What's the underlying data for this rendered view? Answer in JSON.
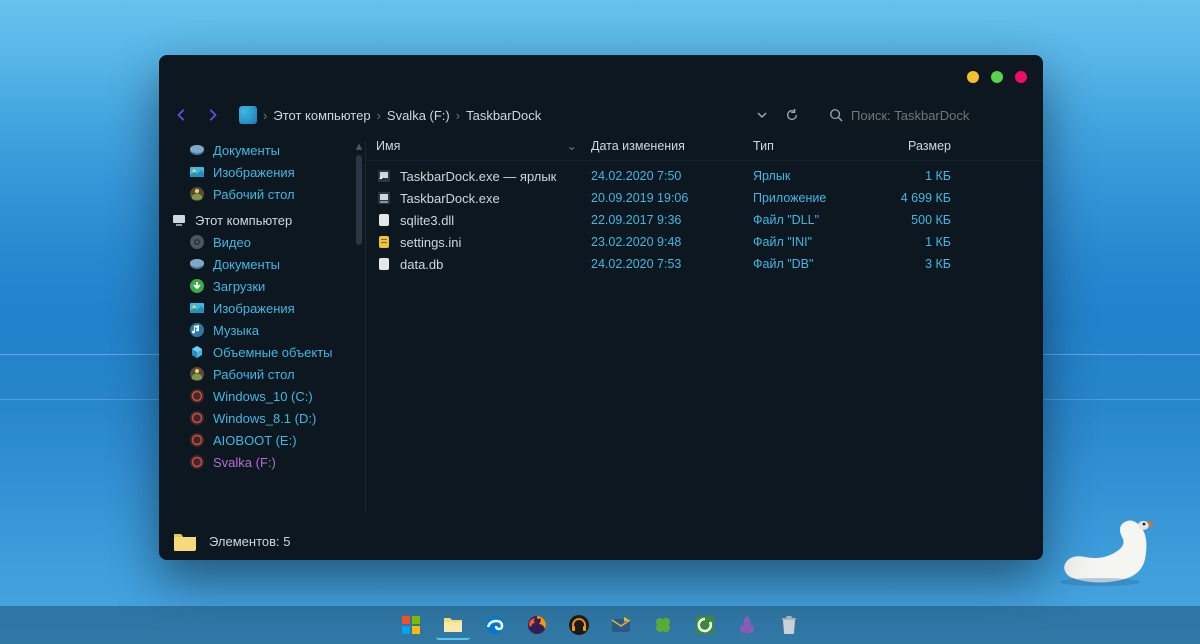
{
  "breadcrumb": {
    "root": "Этот компьютер",
    "drive": "Svalka (F:)",
    "folder": "TaskbarDock"
  },
  "search": {
    "placeholder": "Поиск: TaskbarDock"
  },
  "columns": {
    "name": "Имя",
    "date": "Дата изменения",
    "type": "Тип",
    "size": "Размер"
  },
  "sidebar": {
    "quick": [
      {
        "label": "Документы",
        "icon": "docs"
      },
      {
        "label": "Изображения",
        "icon": "images"
      },
      {
        "label": "Рабочий стол",
        "icon": "desktop"
      }
    ],
    "pc_label": "Этот компьютер",
    "pc": [
      {
        "label": "Видео",
        "icon": "video"
      },
      {
        "label": "Документы",
        "icon": "docs"
      },
      {
        "label": "Загрузки",
        "icon": "downloads"
      },
      {
        "label": "Изображения",
        "icon": "images"
      },
      {
        "label": "Музыка",
        "icon": "music"
      },
      {
        "label": "Объемные объекты",
        "icon": "3d"
      },
      {
        "label": "Рабочий стол",
        "icon": "desktop"
      },
      {
        "label": "Windows_10 (C:)",
        "icon": "drive-red"
      },
      {
        "label": "Windows_8.1 (D:)",
        "icon": "drive-red"
      },
      {
        "label": "AIOBOOT (E:)",
        "icon": "drive-red"
      },
      {
        "label": "Svalka (F:)",
        "icon": "drive-red",
        "active": true
      }
    ]
  },
  "files": [
    {
      "name": "TaskbarDock.exe — ярлык",
      "date": "24.02.2020 7:50",
      "type": "Ярлык",
      "size": "1 КБ",
      "icon": "shortcut"
    },
    {
      "name": "TaskbarDock.exe",
      "date": "20.09.2019 19:06",
      "type": "Приложение",
      "size": "4 699 КБ",
      "icon": "exe"
    },
    {
      "name": "sqlite3.dll",
      "date": "22.09.2017 9:36",
      "type": "Файл \"DLL\"",
      "size": "500 КБ",
      "icon": "file"
    },
    {
      "name": "settings.ini",
      "date": "23.02.2020 9:48",
      "type": "Файл \"INI\"",
      "size": "1 КБ",
      "icon": "ini"
    },
    {
      "name": "data.db",
      "date": "24.02.2020 7:53",
      "type": "Файл \"DB\"",
      "size": "3 КБ",
      "icon": "file"
    }
  ],
  "status": {
    "label": "Элементов: 5"
  },
  "taskbar": [
    "start",
    "explorer",
    "edge",
    "firefox",
    "headphones",
    "thunderbird",
    "clover",
    "camtasia",
    "lightshot",
    "trash"
  ]
}
